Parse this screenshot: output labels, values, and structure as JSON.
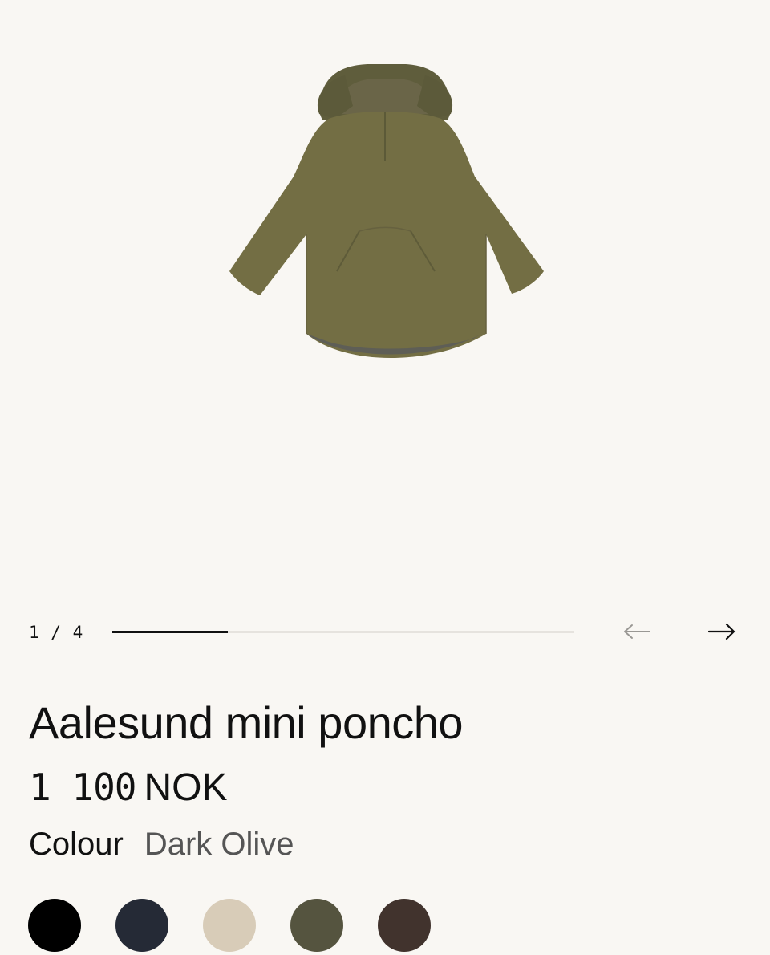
{
  "gallery": {
    "image_alt": "Aalesund mini poncho in Dark Olive",
    "counter": "1 / 4",
    "progress": 0.25,
    "prev_icon": "arrow-left-icon",
    "next_icon": "arrow-right-icon"
  },
  "product": {
    "title": "Aalesund mini poncho",
    "price_amount": "1 100",
    "price_currency": "NOK",
    "colour_label": "Colour",
    "colour_value": "Dark Olive"
  },
  "swatches": [
    {
      "name": "Black",
      "color": "#000000"
    },
    {
      "name": "Navy",
      "color": "#252a36"
    },
    {
      "name": "Beige",
      "color": "#d8ccb8"
    },
    {
      "name": "Dark Olive",
      "color": "#55543f"
    },
    {
      "name": "Brown",
      "color": "#41332d"
    }
  ],
  "colors": {
    "background": "#f9f7f3",
    "jacket": "#736e44",
    "text": "#111111",
    "muted_text": "#555555"
  }
}
